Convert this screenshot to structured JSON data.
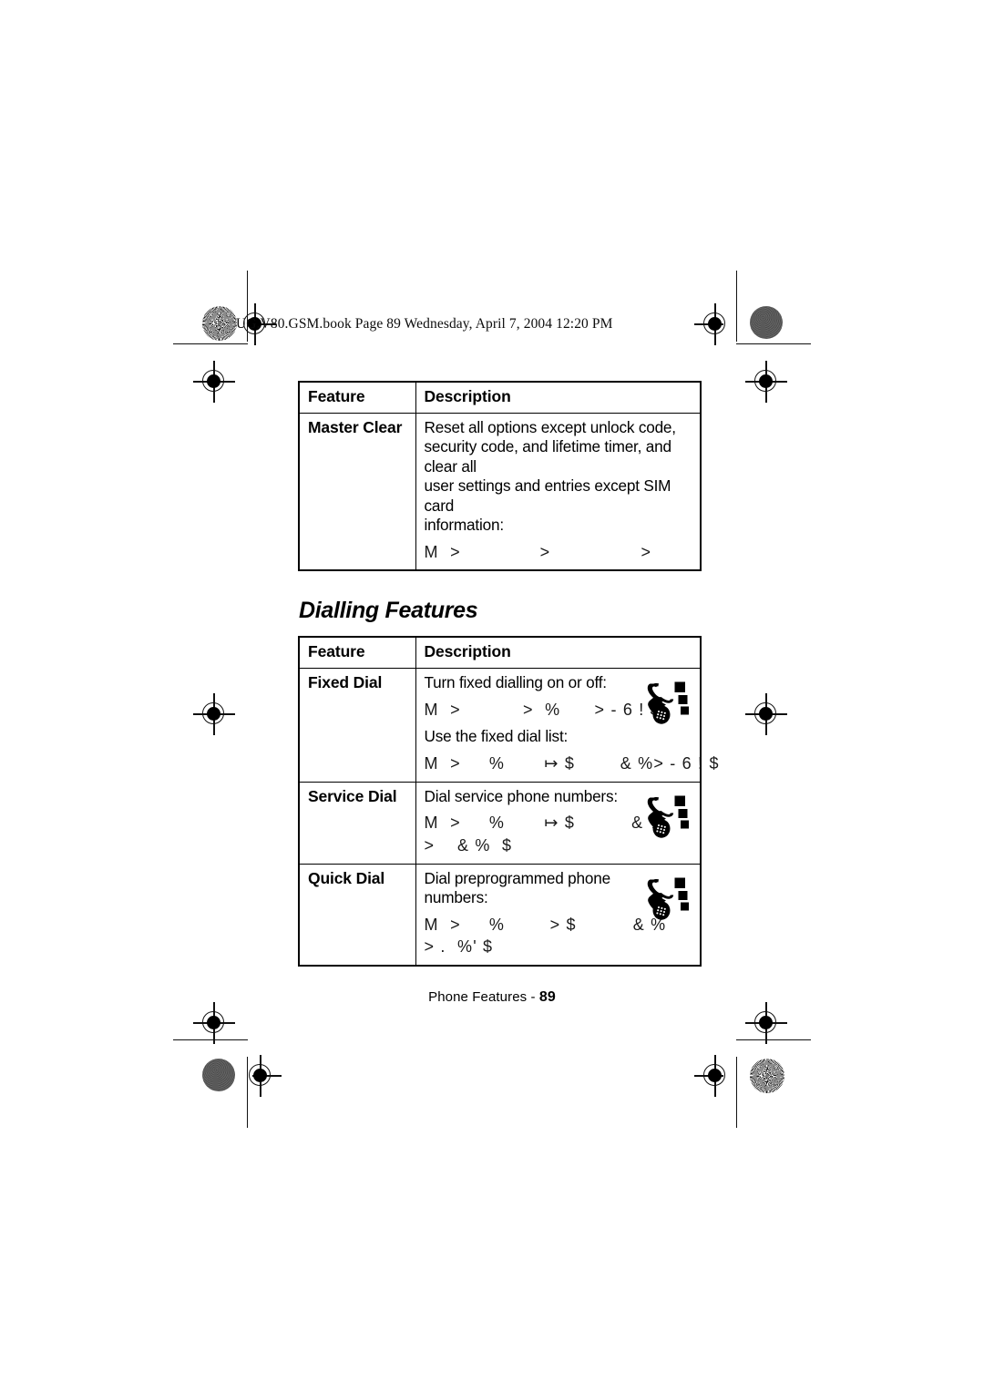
{
  "page": {
    "header_slug": "UG.V80.GSM.book  Page 89  Wednesday, April 7, 2004  12:20 PM",
    "footer_label": "Phone Features - ",
    "footer_page_number": "89"
  },
  "table_master_clear": {
    "headers": {
      "feature": "Feature",
      "description": "Description"
    },
    "rows": [
      {
        "feature": "Master Clear",
        "desc_lines": [
          "Reset all options except unlock code,",
          "security code, and lifetime timer, and clear all",
          "user settings and entries except SIM card",
          "information:"
        ],
        "nav_paths": [
          "M  >              >                >"
        ],
        "icon": null
      }
    ]
  },
  "section": {
    "title": "Dialling Features"
  },
  "table_dialling": {
    "headers": {
      "feature": "Feature",
      "description": "Description"
    },
    "rows": [
      {
        "feature": "Fixed Dial",
        "desc_lines": [
          "Turn fixed dialling on or off:"
        ],
        "nav_paths": [
          "M  >           >  %      > - 6 ! $"
        ],
        "desc_lines_2": [
          "Use the fixed dial list:"
        ],
        "nav_paths_2": [
          "M  >     %       ↦ $        & %> - 6 ! $"
        ],
        "icon": "flip-phone-icon"
      },
      {
        "feature": "Service Dial",
        "desc_lines": [
          "Dial service phone numbers:"
        ],
        "nav_paths": [
          "M  >     %       ↦ $          & %",
          ">    & %  $"
        ],
        "icon": "flip-phone-icon"
      },
      {
        "feature": "Quick Dial",
        "desc_lines": [
          "Dial preprogrammed phone",
          "numbers:"
        ],
        "nav_paths": [
          "M  >     %        > $          & %",
          "> .  %' $"
        ],
        "icon": "flip-phone-icon"
      }
    ]
  }
}
